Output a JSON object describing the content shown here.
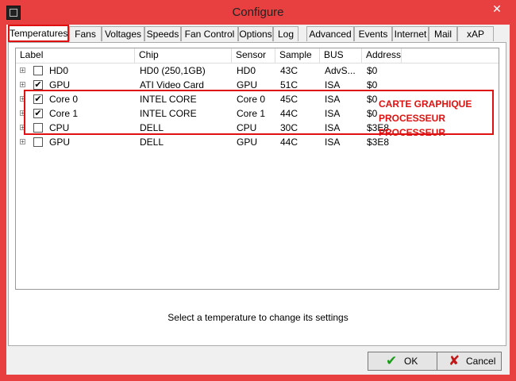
{
  "window": {
    "title": "Configure",
    "close_symbol": "✕"
  },
  "tabs": [
    "Temperatures",
    "Fans",
    "Voltages",
    "Speeds",
    "Fan Control",
    "Options",
    "Log",
    "Advanced",
    "Events",
    "Internet",
    "Mail",
    "xAP"
  ],
  "columns": [
    "Label",
    "Chip",
    "Sensor",
    "Sample",
    "BUS",
    "Address"
  ],
  "rows": [
    {
      "label": "HD0",
      "chip": "HD0 (250,1GB)",
      "sensor": "HD0",
      "sample": "43C",
      "bus": "AdvS...",
      "address": "$0",
      "checked": false
    },
    {
      "label": "GPU",
      "chip": "ATI Video Card",
      "sensor": "GPU",
      "sample": "51C",
      "bus": "ISA",
      "address": "$0",
      "checked": true
    },
    {
      "label": "Core 0",
      "chip": "INTEL CORE",
      "sensor": "Core 0",
      "sample": "45C",
      "bus": "ISA",
      "address": "$0",
      "checked": true
    },
    {
      "label": "Core 1",
      "chip": "INTEL CORE",
      "sensor": "Core 1",
      "sample": "44C",
      "bus": "ISA",
      "address": "$0",
      "checked": true
    },
    {
      "label": "CPU",
      "chip": "DELL",
      "sensor": "CPU",
      "sample": "30C",
      "bus": "ISA",
      "address": "$3E8",
      "checked": false
    },
    {
      "label": "GPU",
      "chip": "DELL",
      "sensor": "GPU",
      "sample": "44C",
      "bus": "ISA",
      "address": "$3E8",
      "checked": false
    }
  ],
  "annotations": [
    "CARTE GRAPHIQUE",
    "PROCESSEUR",
    "PROCESSEUR"
  ],
  "status": "Select a temperature to change its settings",
  "buttons": {
    "ok": "OK",
    "cancel": "Cancel"
  },
  "colors": {
    "frame": "#e84040",
    "annotation": "#e01010"
  },
  "icons": {
    "ok": "checkmark-icon",
    "cancel": "x-icon",
    "expander": "plus-icon"
  }
}
